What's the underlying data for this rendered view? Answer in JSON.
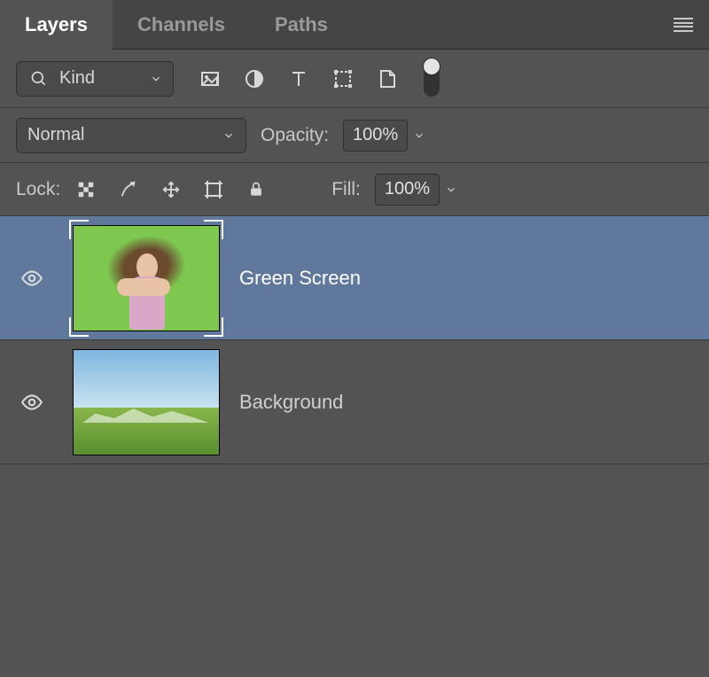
{
  "tabs": [
    "Layers",
    "Channels",
    "Paths"
  ],
  "active_tab": 0,
  "filter": {
    "label": "Kind",
    "type_icons": [
      "image",
      "adjustment",
      "type",
      "shape",
      "smartobject"
    ]
  },
  "blend": {
    "mode": "Normal",
    "opacity_label": "Opacity:",
    "opacity_value": "100%"
  },
  "lock": {
    "label": "Lock:",
    "fill_label": "Fill:",
    "fill_value": "100%"
  },
  "layers": [
    {
      "name": "Green Screen",
      "visible": true,
      "selected": true,
      "thumb_kind": "greenscreen"
    },
    {
      "name": "Background",
      "visible": true,
      "selected": false,
      "thumb_kind": "landscape"
    }
  ]
}
